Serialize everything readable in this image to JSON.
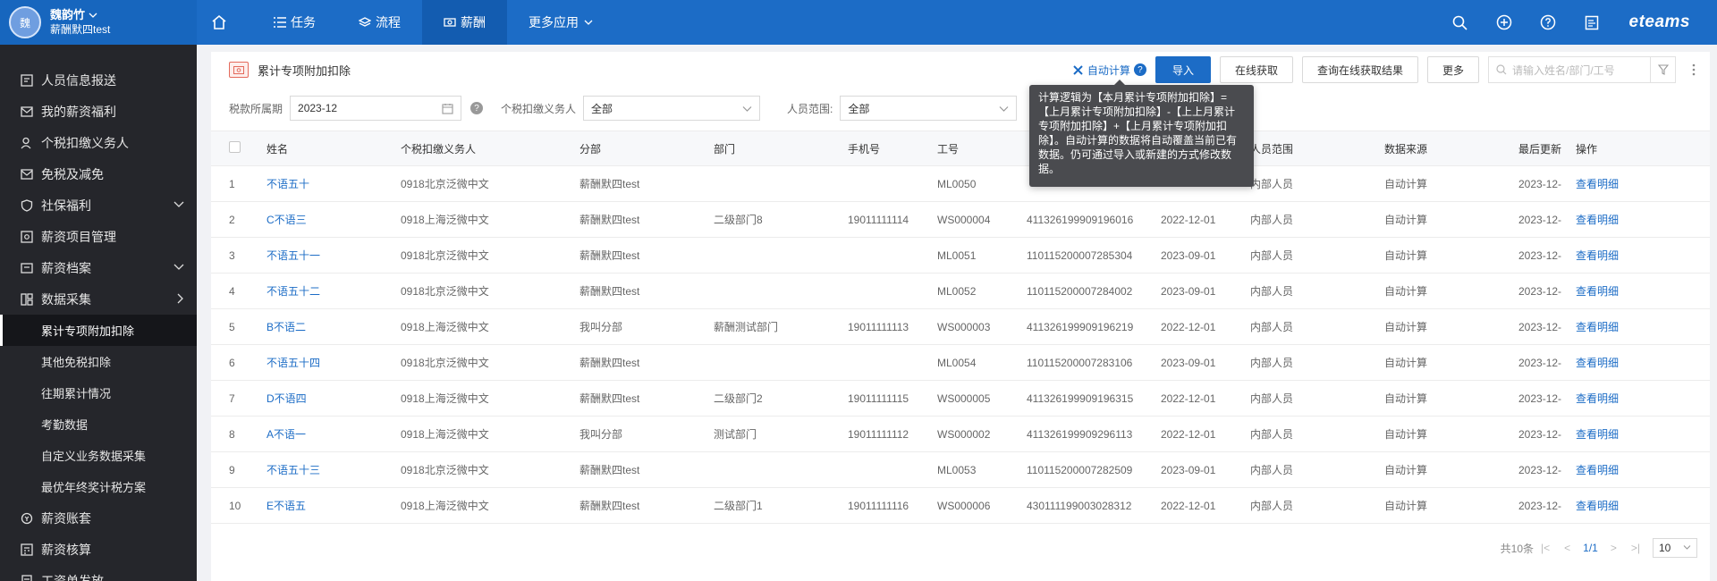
{
  "app": {
    "user_name": "魏韵竹",
    "user_avatar": "魏",
    "user_org": "薪酬默四test",
    "brand": "eteams",
    "nav": [
      {
        "label": "任务",
        "icon": "list-icon"
      },
      {
        "label": "流程",
        "icon": "layers-icon"
      },
      {
        "label": "薪酬",
        "icon": "salary-icon"
      },
      {
        "label": "更多应用",
        "icon": "chevron-down-icon"
      }
    ],
    "active_nav": "薪酬"
  },
  "sidebar": {
    "items": [
      {
        "label": "人员信息报送"
      },
      {
        "label": "我的薪资福利"
      },
      {
        "label": "个税扣缴义务人"
      },
      {
        "label": "免税及减免"
      },
      {
        "label": "社保福利"
      },
      {
        "label": "薪资项目管理"
      },
      {
        "label": "薪资档案"
      },
      {
        "label": "数据采集"
      },
      {
        "label": "累计专项附加扣除"
      },
      {
        "label": "其他免税扣除"
      },
      {
        "label": "往期累计情况"
      },
      {
        "label": "考勤数据"
      },
      {
        "label": "自定义业务数据采集"
      },
      {
        "label": "最优年终奖计税方案"
      },
      {
        "label": "薪资账套"
      },
      {
        "label": "薪资核算"
      },
      {
        "label": "工资单发放"
      }
    ]
  },
  "page": {
    "title": "累计专项附加扣除",
    "auto_calc": "自动计算",
    "buttons": {
      "import": "导入",
      "online_fetch": "在线获取",
      "query_online": "查询在线获取结果",
      "more": "更多"
    },
    "search_placeholder": "请输入姓名/部门/工号",
    "tooltip": "计算逻辑为【本月累计专项附加扣除】=【上月累计专项附加扣除】-【上上月累计专项附加扣除】+【上月累计专项附加扣除】。自动计算的数据将自动覆盖当前已有数据。仍可通过导入或新建的方式修改数据。"
  },
  "filters": {
    "period_label": "税款所属期",
    "period_value": "2023-12",
    "agent_label": "个税扣缴义务人",
    "agent_value": "全部",
    "scope_label": "人员范围:",
    "scope_value": "全部"
  },
  "table": {
    "headers": [
      "姓名",
      "个税扣缴义务人",
      "分部",
      "部门",
      "手机号",
      "工号",
      "",
      "",
      "人员范围",
      "数据来源",
      "最后更新",
      "操作"
    ],
    "rows": [
      [
        "1",
        "不语五十",
        "0918北京泛微中文",
        "薪酬默四test",
        "",
        "",
        "ML0050",
        "",
        "",
        "内部人员",
        "自动计算",
        "2023-12-",
        "查看明细"
      ],
      [
        "2",
        "C不语三",
        "0918上海泛微中文",
        "薪酬默四test",
        "二级部门8",
        "19011111114",
        "WS000004",
        "411326199909196016",
        "2022-12-01",
        "内部人员",
        "自动计算",
        "2023-12-",
        "查看明细"
      ],
      [
        "3",
        "不语五十一",
        "0918北京泛微中文",
        "薪酬默四test",
        "",
        "",
        "ML0051",
        "110115200007285304",
        "2023-09-01",
        "内部人员",
        "自动计算",
        "2023-12-",
        "查看明细"
      ],
      [
        "4",
        "不语五十二",
        "0918北京泛微中文",
        "薪酬默四test",
        "",
        "",
        "ML0052",
        "110115200007284002",
        "2023-09-01",
        "内部人员",
        "自动计算",
        "2023-12-",
        "查看明细"
      ],
      [
        "5",
        "B不语二",
        "0918上海泛微中文",
        "我叫分部",
        "薪酬测试部门",
        "19011111113",
        "WS000003",
        "411326199909196219",
        "2022-12-01",
        "内部人员",
        "自动计算",
        "2023-12-",
        "查看明细"
      ],
      [
        "6",
        "不语五十四",
        "0918北京泛微中文",
        "薪酬默四test",
        "",
        "",
        "ML0054",
        "110115200007283106",
        "2023-09-01",
        "内部人员",
        "自动计算",
        "2023-12-",
        "查看明细"
      ],
      [
        "7",
        "D不语四",
        "0918上海泛微中文",
        "薪酬默四test",
        "二级部门2",
        "19011111115",
        "WS000005",
        "411326199909196315",
        "2022-12-01",
        "内部人员",
        "自动计算",
        "2023-12-",
        "查看明细"
      ],
      [
        "8",
        "A不语一",
        "0918上海泛微中文",
        "我叫分部",
        "测试部门",
        "19011111112",
        "WS000002",
        "411326199909296113",
        "2022-12-01",
        "内部人员",
        "自动计算",
        "2023-12-",
        "查看明细"
      ],
      [
        "9",
        "不语五十三",
        "0918北京泛微中文",
        "薪酬默四test",
        "",
        "",
        "ML0053",
        "110115200007282509",
        "2023-09-01",
        "内部人员",
        "自动计算",
        "2023-12-",
        "查看明细"
      ],
      [
        "10",
        "E不语五",
        "0918上海泛微中文",
        "薪酬默四test",
        "二级部门1",
        "19011111116",
        "WS000006",
        "430111199003028312",
        "2022-12-01",
        "内部人员",
        "自动计算",
        "2023-12-",
        "查看明细"
      ]
    ]
  },
  "pager": {
    "total": "共10条",
    "current": "1/1",
    "page_size": "10"
  }
}
